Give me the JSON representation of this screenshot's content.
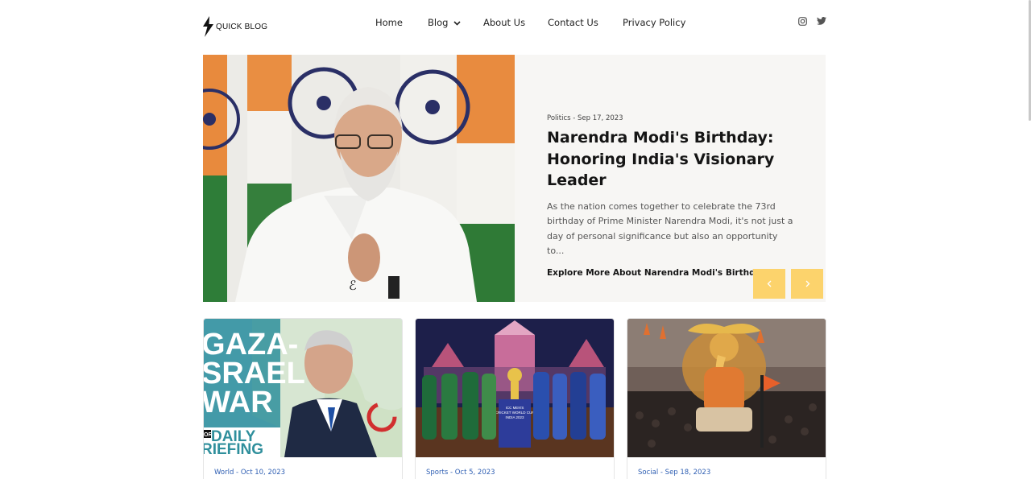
{
  "site": {
    "logo_text": "QUICK BLOG",
    "logo_icon": "lightning-bolt-icon"
  },
  "nav": {
    "items": [
      {
        "label": "Home"
      },
      {
        "label": "Blog",
        "has_dropdown": true
      },
      {
        "label": "About Us"
      },
      {
        "label": "Contact Us"
      },
      {
        "label": "Privacy Policy"
      }
    ]
  },
  "social": {
    "icons": [
      "instagram-icon",
      "twitter-icon"
    ]
  },
  "hero": {
    "category": "Politics",
    "date": "Sep 17, 2023",
    "meta": "Politics - Sep 17, 2023",
    "title": "Narendra Modi's Birthday: Honoring India's Visionary Leader",
    "excerpt": "As the nation comes together to celebrate the 73rd birthday of Prime Minister Narendra Modi, it's not just a day of personal significance but also an opportunity to...",
    "link_label": "Explore More About Narendra Modi's Birthday",
    "image_overlay_symbol": "ℰ"
  },
  "slider": {
    "prev_icon": "chevron-left-icon",
    "next_icon": "chevron-right-icon"
  },
  "cards": [
    {
      "meta": "World - Oct 10, 2023",
      "image_text": {
        "line1": "GAZA-",
        "line2": "SRAEL",
        "line3": "WAR",
        "badge": "OR",
        "line4": "DAILY",
        "line5": "RIEFING"
      }
    },
    {
      "meta": "Sports - Oct 5, 2023",
      "image_text": {
        "trophy_line1": "ICC MEN'S",
        "trophy_line2": "CRICKET WORLD CUP",
        "trophy_line3": "INDIA 2023"
      }
    },
    {
      "meta": "Social - Sep 18, 2023",
      "image_text": {}
    }
  ],
  "colors": {
    "accent_yellow": "#fcd36c",
    "meta_blue": "#2f5fb3",
    "hero_bg": "#f7f6f4"
  }
}
